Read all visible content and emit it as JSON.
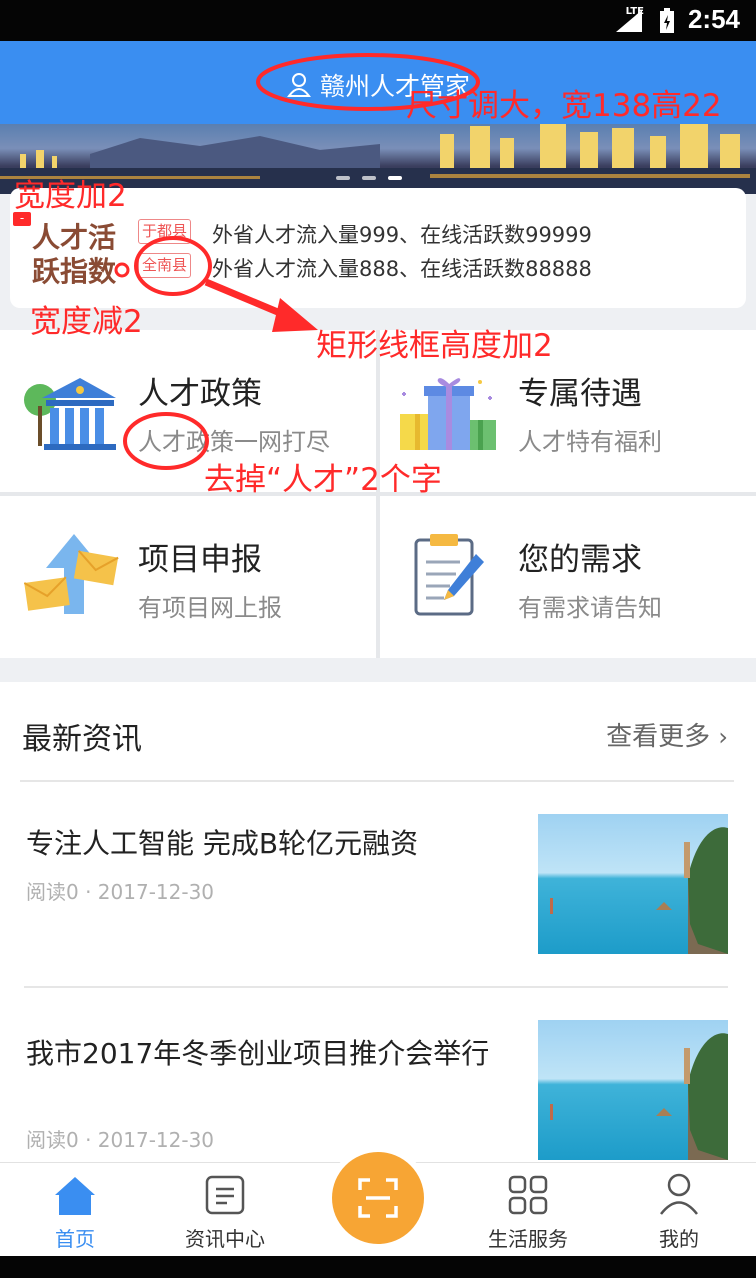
{
  "status_bar": {
    "time": "2:54",
    "network": "LTE"
  },
  "header": {
    "title": "赣州人才管家"
  },
  "talent_activity": {
    "label_line1": "人才活",
    "label_line2": "跃指数",
    "rows": [
      {
        "county": "于都县",
        "text": "外省人才流入量999、在线活跃数99999"
      },
      {
        "county": "全南县",
        "text": "外省人才流入量888、在线活跃数88888"
      }
    ]
  },
  "services": [
    {
      "title": "人才政策",
      "subtitle": "人才政策一网打尽",
      "icon": "bank-building-icon"
    },
    {
      "title": "专属待遇",
      "subtitle": "人才特有福利",
      "icon": "gift-box-icon"
    },
    {
      "title": "项目申报",
      "subtitle": "有项目网上报",
      "icon": "envelope-upload-icon"
    },
    {
      "title": "您的需求",
      "subtitle": "有需求请告知",
      "icon": "clipboard-pen-icon"
    }
  ],
  "news": {
    "title": "最新资讯",
    "more": "查看更多",
    "items": [
      {
        "title": "专注人工智能 完成B轮亿元融资",
        "meta": "阅读0 · 2017-12-30"
      },
      {
        "title": "我市2017年冬季创业项目推介会举行",
        "meta": "阅读0 · 2017-12-30"
      }
    ]
  },
  "tabbar": {
    "items": [
      {
        "label": "首页",
        "active": true
      },
      {
        "label": "资讯中心",
        "active": false
      },
      {
        "label": "",
        "active": false
      },
      {
        "label": "生活服务",
        "active": false
      },
      {
        "label": "我的",
        "active": false
      }
    ]
  },
  "annotations": {
    "header_size": "尺寸调大，宽138高22",
    "width_plus": "宽度加2",
    "width_minus": "宽度减2",
    "rect_height": "矩形线框高度加2",
    "remove_words": "去掉“人才”2个字",
    "minus_sign": "-"
  },
  "colors": {
    "primary": "#3a8ef1",
    "scan_button": "#f7a534",
    "annotation": "#ff2a2a"
  }
}
